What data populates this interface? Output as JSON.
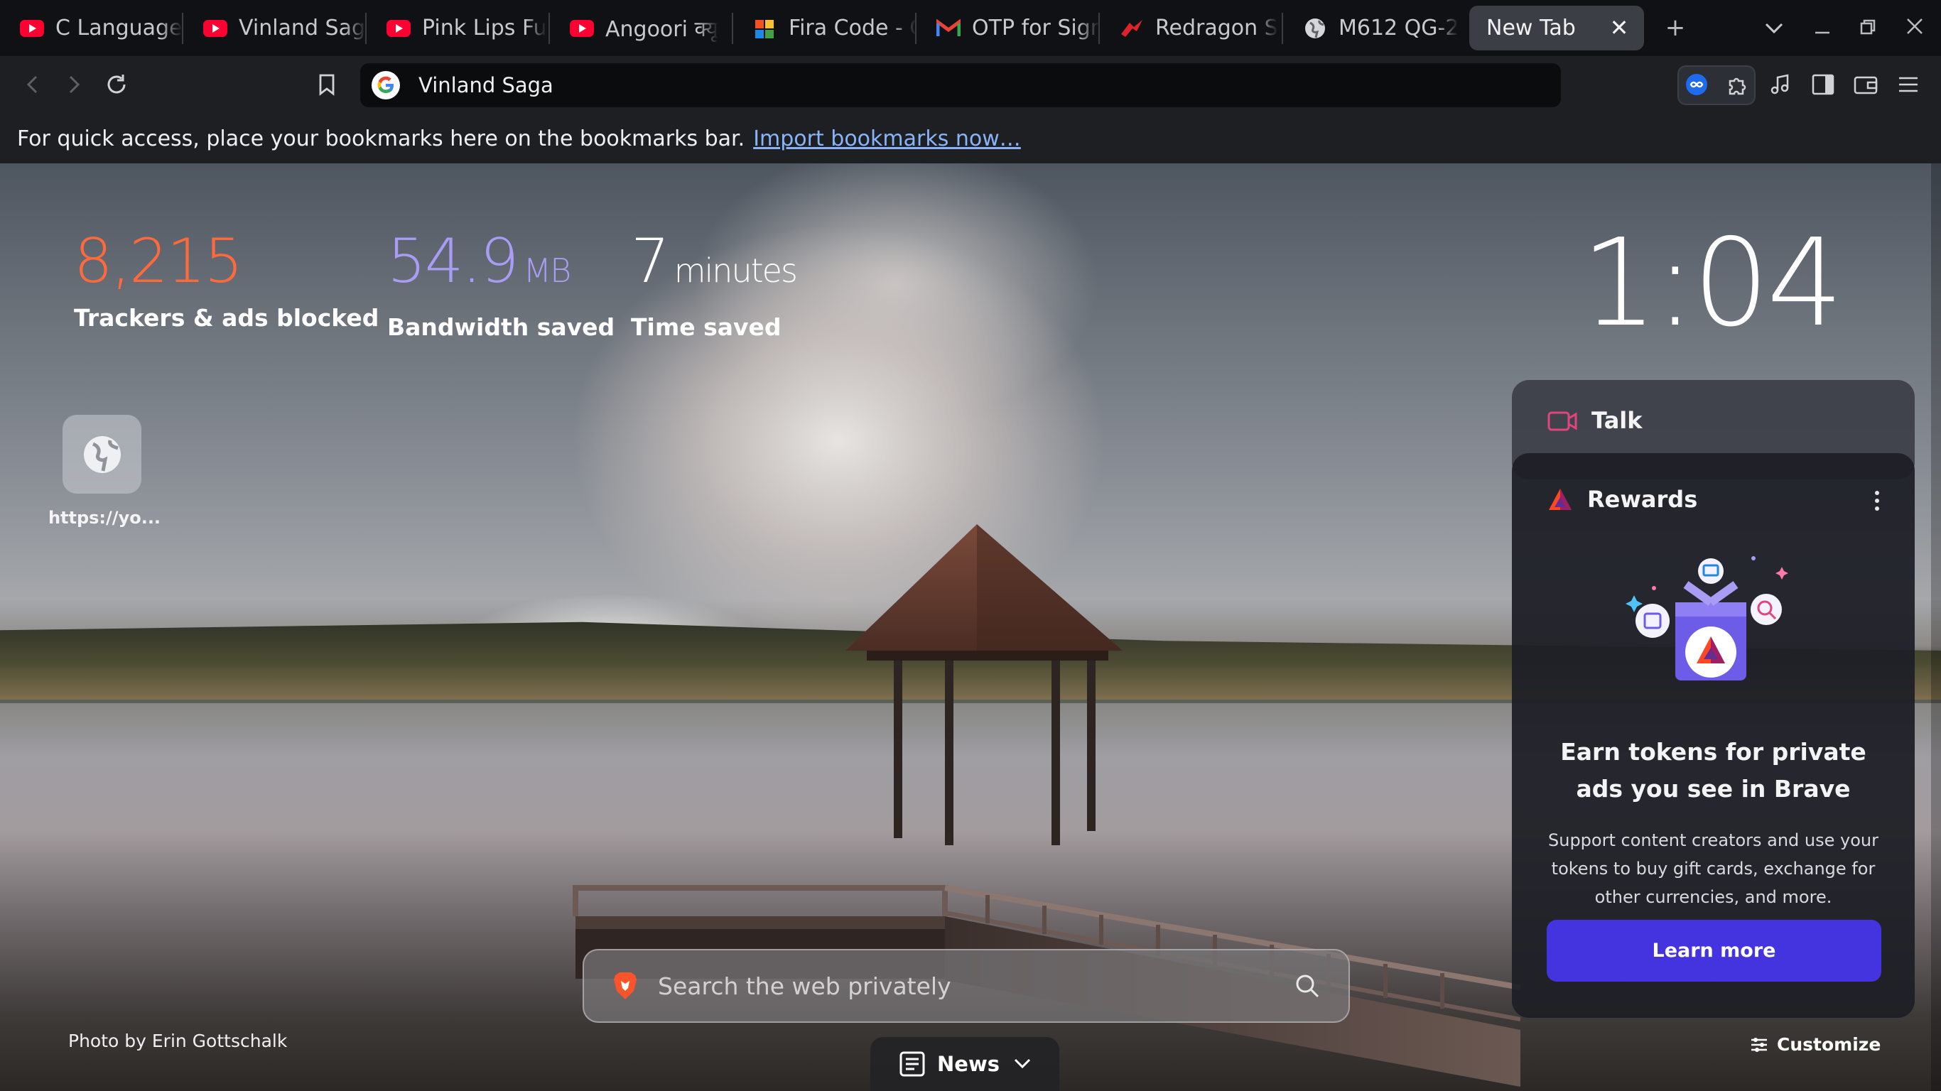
{
  "tabs": [
    {
      "title": "C Language",
      "icon": "youtube-icon"
    },
    {
      "title": "Vinland Saga",
      "icon": "youtube-icon"
    },
    {
      "title": "Pink Lips Fu",
      "icon": "youtube-icon"
    },
    {
      "title": "Angoori क्यू",
      "icon": "youtube-icon"
    },
    {
      "title": "Fira Code - C",
      "icon": "fira-code-icon"
    },
    {
      "title": "OTP for Sign",
      "icon": "gmail-icon"
    },
    {
      "title": "Redragon S",
      "icon": "redragon-icon"
    },
    {
      "title": "M612 QG-2",
      "icon": "globe-icon"
    },
    {
      "title": "New Tab",
      "icon": "",
      "active": true
    }
  ],
  "omnibox": {
    "value": "Vinland Saga"
  },
  "bookmarks_bar": {
    "message": "For quick access, place your bookmarks here on the bookmarks bar.",
    "import_link": "Import bookmarks now…"
  },
  "stats": {
    "trackers": {
      "value": "8,215",
      "label": "Trackers & ads blocked",
      "color": "#ff6a3d"
    },
    "bandwidth": {
      "value": "54.9",
      "unit": "MB",
      "label": "Bandwidth saved",
      "color": "#a89cf5"
    },
    "time": {
      "value": "7",
      "unit": "minutes",
      "label": "Time saved",
      "color": "#ffffff"
    }
  },
  "clock": "1:04",
  "top_sites": [
    {
      "label": "https://yo..."
    }
  ],
  "talk": {
    "title": "Talk"
  },
  "rewards": {
    "title": "Rewards",
    "heading": "Earn tokens for private ads you see in Brave",
    "body": "Support content creators and use your tokens to buy gift cards, exchange for other currencies, and more.",
    "button": "Learn more"
  },
  "search": {
    "placeholder": "Search the web privately"
  },
  "photo_credit": "Photo by Erin Gottschalk",
  "news": {
    "label": "News"
  },
  "customize": {
    "label": "Customize"
  },
  "colors": {
    "accent": "#4434e0",
    "trackers": "#ff6a3d",
    "bandwidth": "#a89cf5"
  }
}
